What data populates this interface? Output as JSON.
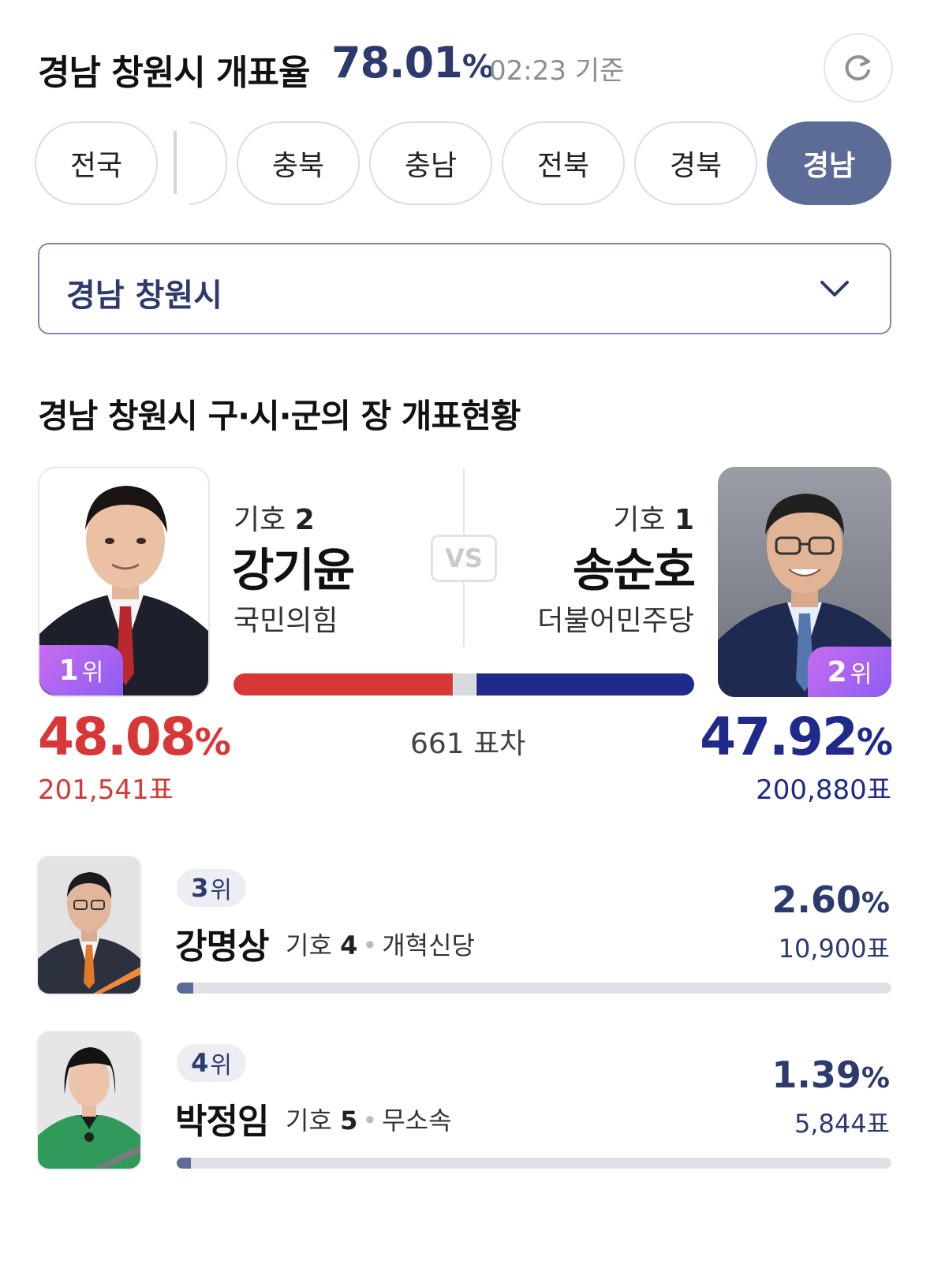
{
  "header": {
    "title": "경남 창원시 개표율",
    "rate_value": "78.01",
    "rate_unit": "%",
    "time": "02:23 기준"
  },
  "tabs": [
    {
      "label": "전국",
      "active": false
    },
    {
      "label": "충북",
      "active": false
    },
    {
      "label": "충남",
      "active": false
    },
    {
      "label": "전북",
      "active": false
    },
    {
      "label": "경북",
      "active": false
    },
    {
      "label": "경남",
      "active": true
    }
  ],
  "dropdown": {
    "selected": "경남 창원시"
  },
  "section_title": "경남 창원시 구·시·군의 장 개표현황",
  "matchup": {
    "vs_label": "VS",
    "diff": "661 표차",
    "bar_share_first": 48.08,
    "bar_share_second": 47.92,
    "first": {
      "rank_num": "1",
      "rank_unit": "위",
      "number_label": "기호",
      "number": "2",
      "name": "강기윤",
      "party": "국민의힘",
      "pct_value": "48.08",
      "pct_unit": "%",
      "votes": "201,541표",
      "color": "#d73737"
    },
    "second": {
      "rank_num": "2",
      "rank_unit": "위",
      "number_label": "기호",
      "number": "1",
      "name": "송순호",
      "party": "더불어민주당",
      "pct_value": "47.92",
      "pct_unit": "%",
      "votes": "200,880표",
      "color": "#1f2a8a"
    }
  },
  "others": [
    {
      "rank_num": "3",
      "rank_unit": "위",
      "name": "강명상",
      "number_label": "기호",
      "number": "4",
      "party": "개혁신당",
      "pct_value": "2.60",
      "pct_unit": "%",
      "votes": "10,900표",
      "share": 2.6
    },
    {
      "rank_num": "4",
      "rank_unit": "위",
      "name": "박정임",
      "number_label": "기호",
      "number": "5",
      "party": "무소속",
      "pct_value": "1.39",
      "pct_unit": "%",
      "votes": "5,844표",
      "share": 1.39
    }
  ],
  "icons": {
    "refresh": "refresh-icon",
    "dropdown": "chevron-down-icon"
  },
  "colors": {
    "accent": "#2d3a6d",
    "active_tab": "#5d6b97",
    "first_party": "#d73737",
    "second_party": "#1f2a8a",
    "rank_badge": "#a764f1"
  }
}
